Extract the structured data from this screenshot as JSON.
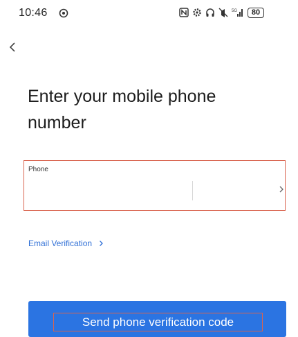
{
  "status_bar": {
    "time": "10:46",
    "battery": "80",
    "network": "5G"
  },
  "header": {
    "back_icon": "chevron-left-icon"
  },
  "title": "Enter your mobile phone number",
  "phone_field": {
    "label": "Phone",
    "value": "",
    "placeholder": ""
  },
  "links": {
    "email_verification": "Email Verification"
  },
  "actions": {
    "send_code": "Send phone verification code"
  },
  "colors": {
    "accent": "#2b74e2",
    "link": "#2f6fd6",
    "highlight": "#d9644f"
  }
}
